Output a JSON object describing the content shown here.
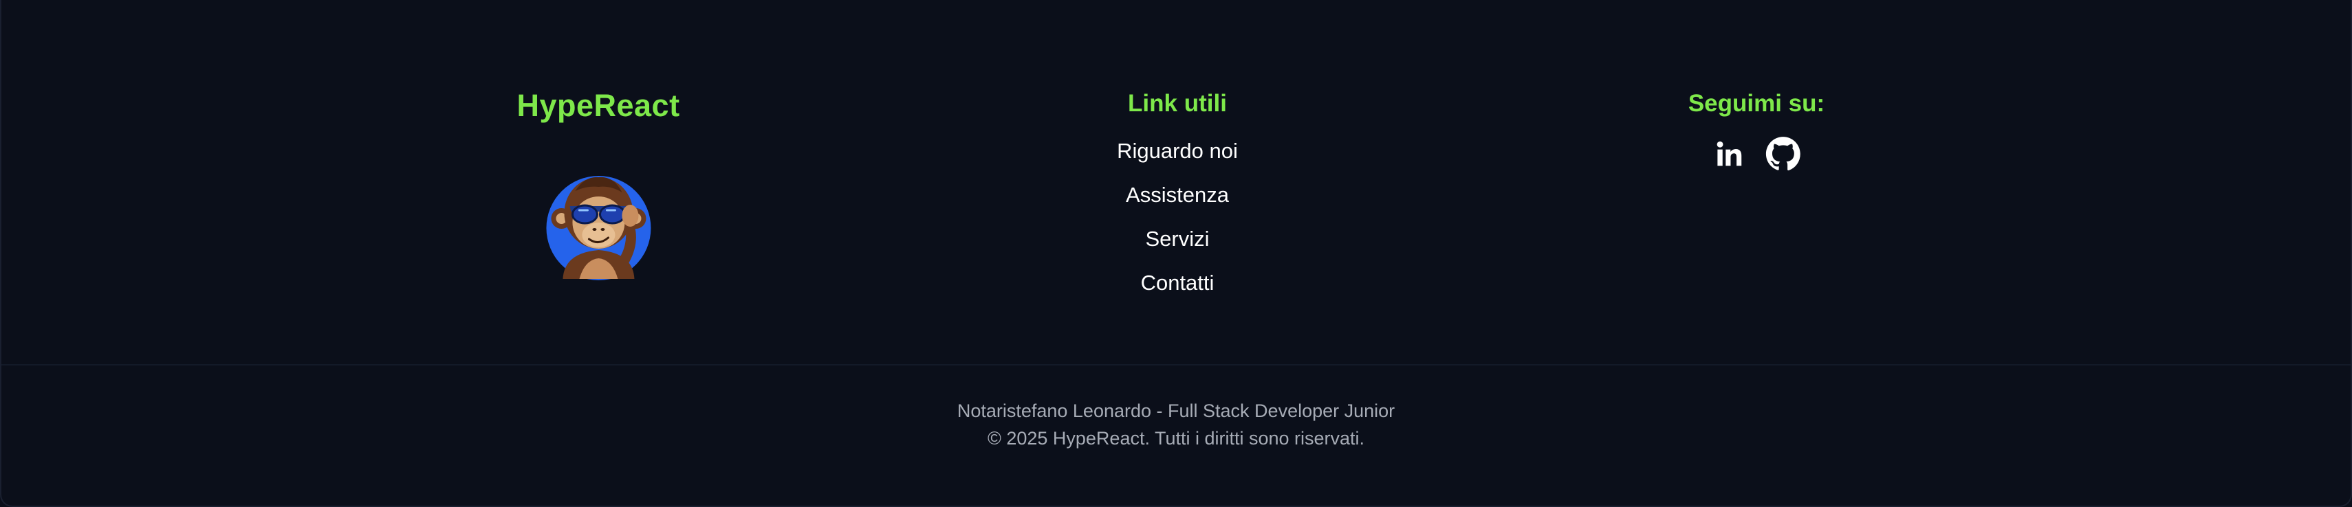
{
  "brand": {
    "name": "HypeReact",
    "accent_color": "#7ee84a",
    "logo_icon": "monkey-sunglasses-logo"
  },
  "links": {
    "title": "Link utili",
    "items": [
      {
        "label": "Riguardo noi"
      },
      {
        "label": "Assistenza"
      },
      {
        "label": "Servizi"
      },
      {
        "label": "Contatti"
      }
    ]
  },
  "social": {
    "title": "Seguimi su:",
    "items": [
      {
        "icon": "linkedin-icon"
      },
      {
        "icon": "github-icon"
      }
    ]
  },
  "bottom": {
    "author": "Notaristefano Leonardo - Full Stack Developer Junior",
    "copyright": "© 2025 HypeReact. Tutti i diritti sono riservati."
  },
  "colors": {
    "background": "#0b0f1a",
    "text": "#ffffff",
    "muted_text": "#a7acb6"
  }
}
